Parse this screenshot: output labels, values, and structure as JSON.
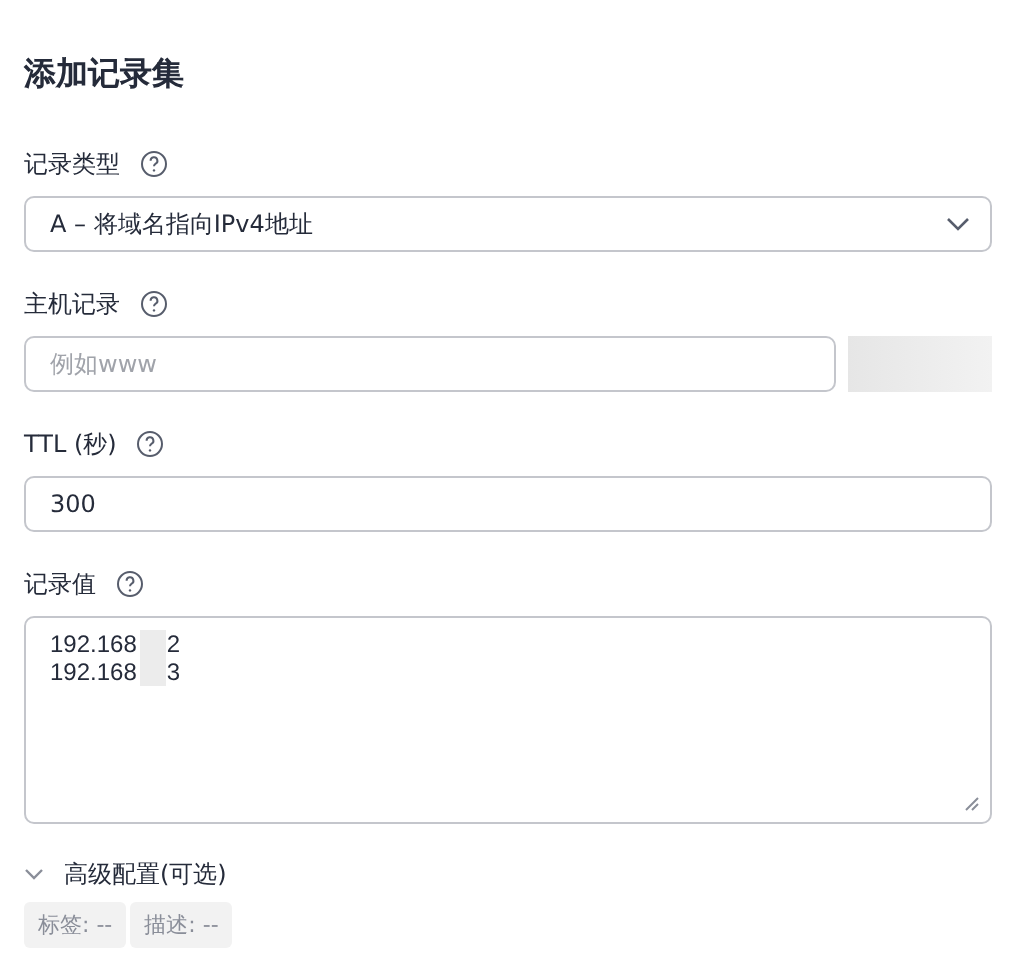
{
  "title": "添加记录集",
  "fields": [
    {
      "kind": "select",
      "label": "记录类型",
      "value": "A – 将域名指向IPv4地址"
    },
    {
      "kind": "input_suffix",
      "label": "主机记录",
      "placeholder": "例如www"
    },
    {
      "kind": "input",
      "label": "TTL (秒)",
      "value": "300"
    },
    {
      "kind": "textarea",
      "label": "记录值",
      "lines": [
        {
          "start": "192.168",
          "end": "2"
        },
        {
          "start": "192.168",
          "end": "3"
        }
      ]
    }
  ],
  "advanced": {
    "label": "高级配置(可选)",
    "expanded": false
  },
  "tags": [
    "标签: --",
    "描述: --"
  ]
}
